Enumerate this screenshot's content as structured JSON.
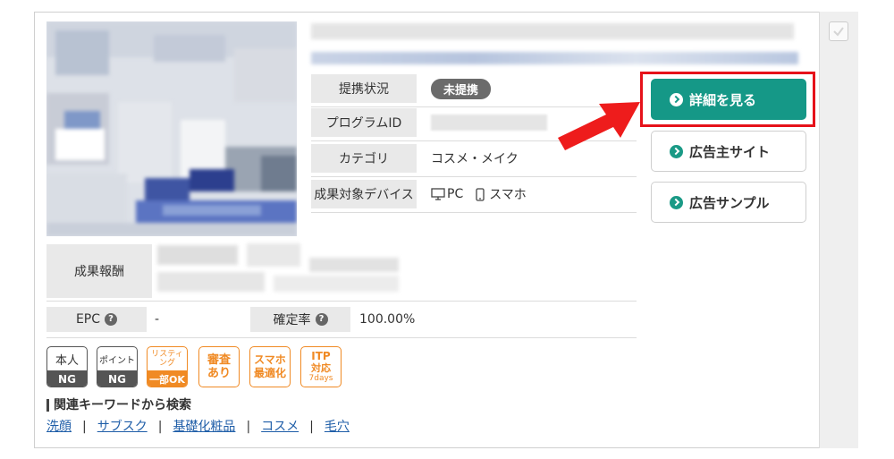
{
  "info": {
    "status_label": "提携状況",
    "status_value": "未提携",
    "program_id_label": "プログラムID",
    "category_label": "カテゴリ",
    "category_value": "コスメ・メイク",
    "device_label": "成果対象デバイス",
    "device_pc": "PC",
    "device_phone": "スマホ"
  },
  "buttons": {
    "details": "詳細を見る",
    "advertiser_site": "広告主サイト",
    "ad_sample": "広告サンプル"
  },
  "reward": {
    "label": "成果報酬"
  },
  "metrics": {
    "epc_label": "EPC",
    "epc_value": "-",
    "approval_label": "確定率",
    "approval_value": "100.00%",
    "help_glyph": "?"
  },
  "tags": [
    {
      "top": "本人",
      "bottom": "NG"
    },
    {
      "top": "ポイント",
      "bottom": "NG"
    },
    {
      "top": "リスティング",
      "bottom": "一部OK"
    },
    {
      "line1": "審査",
      "line2": "あり"
    },
    {
      "line1": "スマホ",
      "line2": "最適化"
    },
    {
      "line1": "ITP",
      "line2": "対応",
      "line3": "7days"
    }
  ],
  "keywords": {
    "title": "関連キーワードから検索",
    "links": [
      "洗顔",
      "サブスク",
      "基礎化粧品",
      "コスメ",
      "毛穴"
    ],
    "separator": "|"
  },
  "colors": {
    "accent": "#159887",
    "highlight": "#e6121a",
    "tag_orange": "#f08a24"
  }
}
